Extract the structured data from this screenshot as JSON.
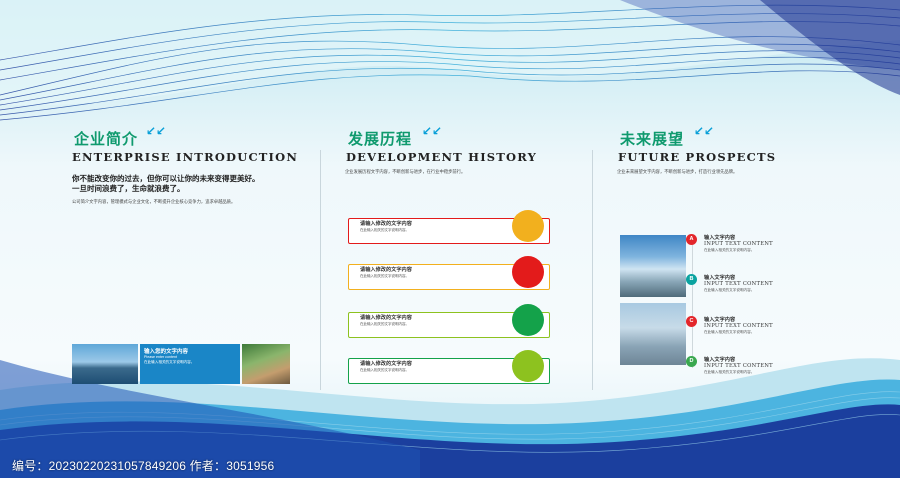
{
  "panels": {
    "intro": {
      "cn_title": "企业简介",
      "arrows": "↙↙",
      "en_title": "ENTERPRISE INTRODUCTION",
      "slogan_line1": "你不能改变你的过去，但你可以让你的未来变得更美好。",
      "slogan_line2": "一旦时间浪费了，生命就浪费了。",
      "paragraph": "公司简介文字内容，管理模式与企业文化，不断提升企业核心竞争力，追求卓越品质。",
      "photo_caption_title": "输入您的文字内容",
      "photo_caption_sub": "Please enter content",
      "photo_caption_desc": "在此输入相关的文字说明内容。"
    },
    "history": {
      "cn_title": "发展历程",
      "arrows": "↙↙",
      "en_title": "DEVELOPMENT HISTORY",
      "paragraph": "企业发展历程文字内容，不断创新与进步，在行业中稳步前行。",
      "steps": [
        {
          "title": "请输入修改的文字内容",
          "desc": "在此输入相关的文字说明内容。",
          "color": "#f2b01e"
        },
        {
          "title": "请输入修改的文字内容",
          "desc": "在此输入相关的文字说明内容。",
          "color": "#e31b1b"
        },
        {
          "title": "请输入修改的文字内容",
          "desc": "在此输入相关的文字说明内容。",
          "color": "#14a24a"
        },
        {
          "title": "请输入修改的文字内容",
          "desc": "在此输入相关的文字说明内容。",
          "color": "#8dc21f"
        }
      ]
    },
    "future": {
      "cn_title": "未来展望",
      "arrows": "↙↙",
      "en_title": "FUTURE PROSPECTS",
      "paragraph": "企业未来展望文字内容，不断创新与进步，打造行业领先品牌。",
      "items": [
        {
          "badge": "A",
          "title": "输入文字内容",
          "en": "INPUT TEXT CONTENT",
          "desc": "在此输入相关的文字说明内容。",
          "color": "#e3262b"
        },
        {
          "badge": "B",
          "title": "输入文字内容",
          "en": "INPUT TEXT CONTENT",
          "desc": "在此输入相关的文字说明内容。",
          "color": "#0aa3a0"
        },
        {
          "badge": "C",
          "title": "输入文字内容",
          "en": "INPUT TEXT CONTENT",
          "desc": "在此输入相关的文字说明内容。",
          "color": "#e3262b"
        },
        {
          "badge": "D",
          "title": "输入文字内容",
          "en": "INPUT TEXT CONTENT",
          "desc": "在此输入相关的文字说明内容。",
          "color": "#3aa84f"
        }
      ]
    }
  },
  "footer": {
    "text": "编号：20230220231057849206 作者：3051956"
  }
}
